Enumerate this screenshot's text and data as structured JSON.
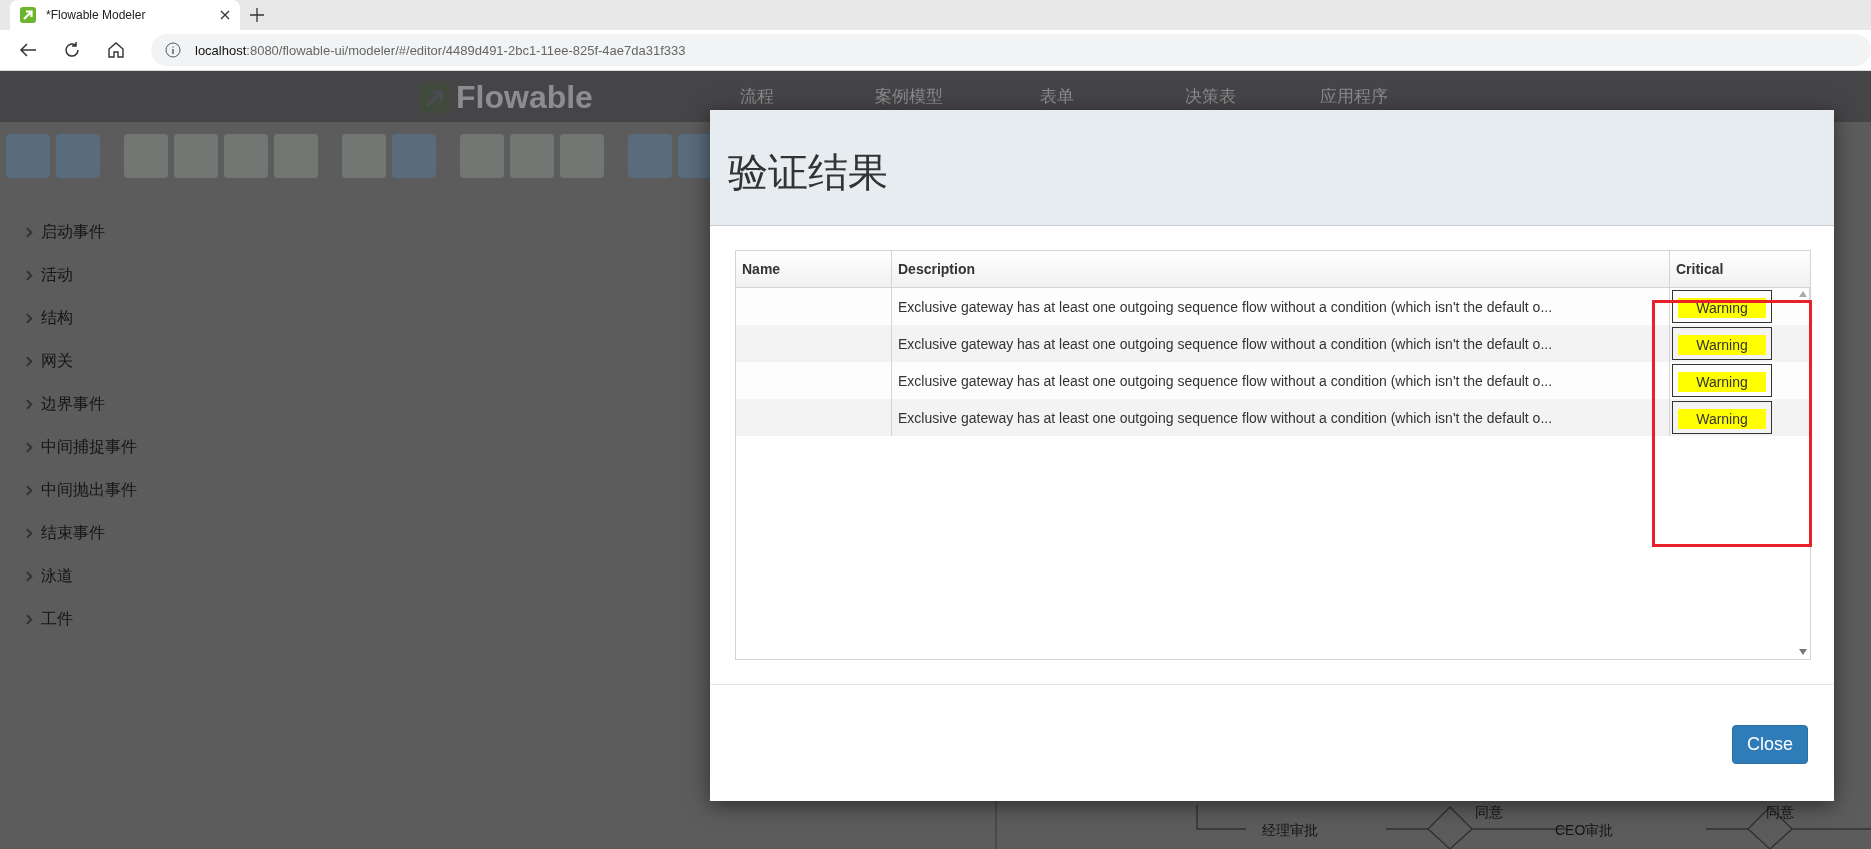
{
  "browser": {
    "tab_title": "*Flowable Modeler",
    "url_host": "localhost",
    "url_path": ":8080/flowable-ui/modeler/#/editor/4489d491-2bc1-11ee-825f-4ae7da31f333"
  },
  "app": {
    "logo": "Flowable",
    "nav": [
      "流程",
      "案例模型",
      "表单",
      "决策表",
      "应用程序"
    ]
  },
  "palette": [
    "启动事件",
    "活动",
    "结构",
    "网关",
    "边界事件",
    "中间捕捉事件",
    "中间抛出事件",
    "结束事件",
    "泳道",
    "工件"
  ],
  "diagram": {
    "labels": [
      "经理审批",
      "同意",
      "CEO审批",
      "同意"
    ]
  },
  "dialog": {
    "title": "验证结果",
    "columns": [
      "Name",
      "Description",
      "Critical"
    ],
    "rows": [
      {
        "name": "",
        "description": "Exclusive gateway has at least one outgoing sequence flow without a condition (which isn't the default o...",
        "critical": "Warning"
      },
      {
        "name": "",
        "description": "Exclusive gateway has at least one outgoing sequence flow without a condition (which isn't the default o...",
        "critical": "Warning"
      },
      {
        "name": "",
        "description": "Exclusive gateway has at least one outgoing sequence flow without a condition (which isn't the default o...",
        "critical": "Warning"
      },
      {
        "name": "",
        "description": "Exclusive gateway has at least one outgoing sequence flow without a condition (which isn't the default o...",
        "critical": "Warning"
      }
    ],
    "close_button": "Close"
  }
}
